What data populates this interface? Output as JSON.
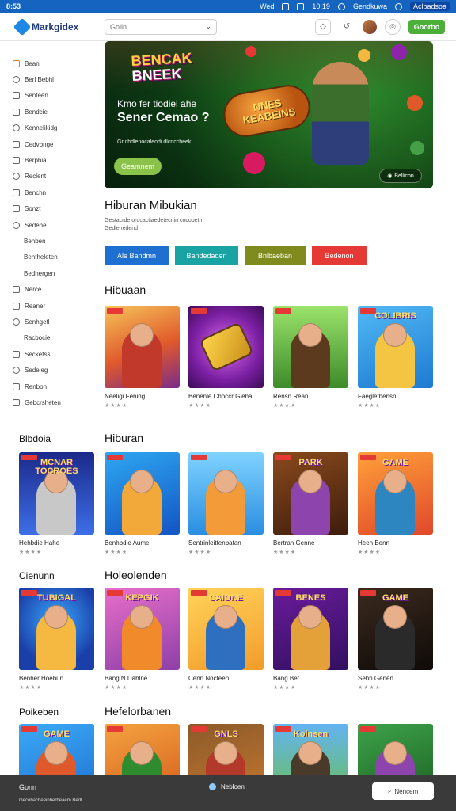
{
  "status_bar": {
    "time": "8:53",
    "items": [
      "Wed",
      "10:19",
      "Gendkuwa",
      "Aclbadsoa"
    ]
  },
  "header": {
    "logo": "Markgidex",
    "search_placeholder": "Goiin",
    "cta": "Goorbo"
  },
  "sidebar": {
    "items": [
      {
        "label": "Bean",
        "icon": "home-icon"
      },
      {
        "label": "Berl Bebhl",
        "icon": "house-icon"
      },
      {
        "label": "Senteen",
        "icon": "tv-icon"
      },
      {
        "label": "Bendcie",
        "icon": "grid-icon"
      },
      {
        "label": "Kennelikidg",
        "icon": "calendar-icon"
      },
      {
        "label": "Cedvbnge",
        "icon": "clock-icon"
      },
      {
        "label": "Berphia",
        "icon": "document-icon"
      },
      {
        "label": "Reclent",
        "icon": "grid-icon"
      },
      {
        "label": "Benchn",
        "icon": "list-icon"
      },
      {
        "label": "Sonzt",
        "icon": "grid-icon"
      },
      {
        "label": "Sedehe",
        "icon": "gear-icon"
      },
      {
        "label": "Benben",
        "icon": "",
        "sub": true
      },
      {
        "label": "Bentheleten",
        "icon": "",
        "sub": true
      },
      {
        "label": "Bedhergen",
        "icon": "",
        "sub": true
      },
      {
        "label": "Nerce",
        "icon": "link-icon"
      },
      {
        "label": "Reaner",
        "icon": "chat-icon"
      },
      {
        "label": "Senhgetl",
        "icon": "shield-icon"
      },
      {
        "label": "Racbocie",
        "icon": "",
        "sub": true
      },
      {
        "label": "Secketss",
        "icon": "upload-icon"
      },
      {
        "label": "Sedeleg",
        "icon": "settings-icon"
      },
      {
        "label": "Renbon",
        "icon": "power-icon"
      },
      {
        "label": "Gebcrsheten",
        "icon": "file-icon"
      }
    ]
  },
  "hero": {
    "logo_line1": "BENCAK",
    "logo_line2": "BNEEK",
    "headline1": "Kmo fer tiodiei ahe",
    "headline2": "Sener Cemao ?",
    "small_text": "Gr chdlenocaleodi dlcnccheek",
    "badge_line1": "NNES",
    "badge_line2": "KEABEINS",
    "primary_button": "Geamnem",
    "secondary_button": "Bellicon"
  },
  "intro": {
    "title": "Hiburan Mibukian",
    "sub1": "Gestacrde ordcactiaedetecnin cocopetn",
    "sub2": "Gedlenedend"
  },
  "filters": [
    {
      "label": "Ale Bandmn",
      "color": "#1e6fd0"
    },
    {
      "label": "Bandedaden",
      "color": "#1aa3a3"
    },
    {
      "label": "Bnlbaeban",
      "color": "#7f8b1f"
    },
    {
      "label": "Bedenon",
      "color": "#e53935"
    }
  ],
  "sections": [
    {
      "title_main": "Hibuaan",
      "title_left": "",
      "cards": [
        {
          "name": "Neeligi Fening",
          "stars": "★★★★",
          "title": "",
          "bg": "linear-gradient(160deg,#f6c45a,#e0592b 55%,#7a2b8a)",
          "figure": "#c0392b"
        },
        {
          "name": "Benenle Choccr Gieha",
          "stars": "★★★★",
          "title": "",
          "bg": "radial-gradient(circle at 50% 50%,#d96cf0,#7b1fa2 60%,#3c0b58)",
          "figure": "transparent"
        },
        {
          "name": "Rensn Rean",
          "stars": "★★★★",
          "title": "",
          "bg": "linear-gradient(180deg,#9be36b,#3d8b2a)",
          "figure": "#5b3a1e"
        },
        {
          "name": "Faeglethensn",
          "stars": "★★★★",
          "title": "COLIBRIS",
          "bg": "linear-gradient(160deg,#52b9f5,#1d7ad1)",
          "figure": "#f4c542"
        }
      ]
    },
    {
      "title_main": "Hiburan",
      "title_left": "Blbdoia",
      "cards": [
        {
          "name": "Hehbdie Hahe",
          "stars": "★★★★",
          "title": "MCNAR TOCROES",
          "bg": "linear-gradient(180deg,#1b2a8a,#3d6ee8)",
          "figure": "#c8c8c8"
        },
        {
          "name": "Benhbdie Aume",
          "stars": "★★★★",
          "title": "",
          "bg": "linear-gradient(160deg,#2ea7f0,#1355c4)",
          "figure": "#f2a93a"
        },
        {
          "name": "Sentrinleittenbatan",
          "stars": "★★★★",
          "title": "",
          "bg": "linear-gradient(180deg,#7fd3ff,#2a8ee0)",
          "figure": "#f29b38"
        },
        {
          "name": "Bertran Genne",
          "stars": "★★★★",
          "title": "PARK",
          "bg": "linear-gradient(160deg,#8a4a1c,#3e1c0c)",
          "figure": "#8e44ad"
        },
        {
          "name": "Heen Benn",
          "stars": "★★★★",
          "title": "GAME",
          "bg": "linear-gradient(160deg,#ffa03a,#e0482a)",
          "figure": "#2e86c1"
        }
      ]
    },
    {
      "title_main": "Holeolenden",
      "title_left": "Cienunn",
      "cards": [
        {
          "name": "Benher Hoebun",
          "stars": "★★★★",
          "title": "TUBIGAL",
          "bg": "radial-gradient(circle at 50% 40%,#38a8ff,#1b3fa8 70%)",
          "figure": "#f5b942"
        },
        {
          "name": "Bang N Dablne",
          "stars": "★★★★",
          "title": "KEPGIK",
          "bg": "linear-gradient(160deg,#e86fc9,#8e3fa8)",
          "figure": "#f08a2a"
        },
        {
          "name": "Cenn Nocteen",
          "stars": "★★★★",
          "title": "CAIONE",
          "bg": "linear-gradient(160deg,#ffd35a,#f39c2a)",
          "figure": "#2f6fbf"
        },
        {
          "name": "Bang Bet",
          "stars": "★★★★",
          "title": "BENES",
          "bg": "linear-gradient(160deg,#6a1b9a,#311060)",
          "figure": "#e4a13a"
        },
        {
          "name": "Sehh Genen",
          "stars": "★★★★",
          "title": "GAME",
          "bg": "linear-gradient(160deg,#3b2a1e,#0f0a08)",
          "figure": "#2a2a2a"
        }
      ]
    },
    {
      "title_main": "Hefelorbanen",
      "title_left": "Poikeben",
      "cards": [
        {
          "name": "",
          "stars": "",
          "title": "GAME",
          "bg": "linear-gradient(160deg,#3ca9f5,#1d6fd1)",
          "figure": "#e0592b"
        },
        {
          "name": "",
          "stars": "",
          "title": "",
          "bg": "linear-gradient(160deg,#f4a340,#d55a1b)",
          "figure": "#2e8b2e"
        },
        {
          "name": "",
          "stars": "",
          "title": "GNLS",
          "bg": "linear-gradient(160deg,#8a5a2a,#c9782e)",
          "figure": "#b33a2a"
        },
        {
          "name": "",
          "stars": "",
          "title": "Kolnsen",
          "bg": "linear-gradient(180deg,#63b4f2,#6bbf4a)",
          "figure": "#4a3a2a"
        },
        {
          "name": "",
          "stars": "",
          "title": "",
          "bg": "linear-gradient(160deg,#3da24a,#1b5e20)",
          "figure": "#8e44ad"
        }
      ]
    }
  ],
  "bottom_bar": {
    "title": "Gonn",
    "sub": "Gecobacheeinherbeaem Bedl",
    "middle": "Nebloen",
    "button": "Nencem"
  }
}
